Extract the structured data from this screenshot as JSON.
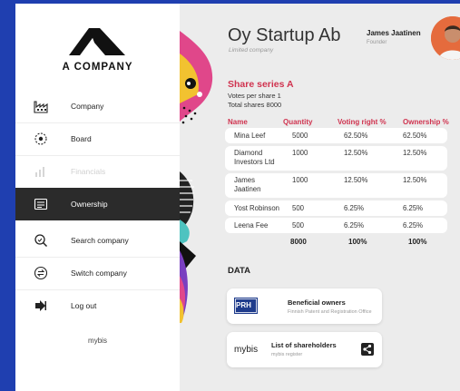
{
  "brand": {
    "company": "A COMPANY",
    "footer": "mybis"
  },
  "nav": [
    {
      "label": "Company",
      "icon": "factory-icon",
      "state": "normal"
    },
    {
      "label": "Board",
      "icon": "board-icon",
      "state": "normal"
    },
    {
      "label": "Financials",
      "icon": "financials-icon",
      "state": "disabled"
    },
    {
      "label": "Ownership",
      "icon": "ownership-icon",
      "state": "active"
    },
    {
      "label": "Search company",
      "icon": "search-icon",
      "state": "normal"
    },
    {
      "label": "Switch company",
      "icon": "switch-icon",
      "state": "normal"
    },
    {
      "label": "Log out",
      "icon": "logout-icon",
      "state": "normal"
    }
  ],
  "header": {
    "company_name": "Oy Startup Ab",
    "company_type": "Limited company",
    "user_name": "James Jaatinen",
    "user_role": "Founder"
  },
  "share_series": {
    "title": "Share series A",
    "votes_per_share": "Votes per share 1",
    "total_shares": "Total shares 8000"
  },
  "table": {
    "columns": [
      "Name",
      "Quantity",
      "Voting right %",
      "Ownership %"
    ],
    "rows": [
      {
        "name": "Mina Leef",
        "quantity": "5000",
        "voting": "62.50%",
        "ownership": "62.50%"
      },
      {
        "name": "Diamond Investors Ltd",
        "quantity": "1000",
        "voting": "12.50%",
        "ownership": "12.50%"
      },
      {
        "name": "James Jaatinen",
        "quantity": "1000",
        "voting": "12.50%",
        "ownership": "12.50%"
      },
      {
        "name": "Yost Robinson",
        "quantity": "500",
        "voting": "6.25%",
        "ownership": "6.25%"
      },
      {
        "name": "Leena Fee",
        "quantity": "500",
        "voting": "6.25%",
        "ownership": "6.25%"
      }
    ],
    "totals": {
      "quantity": "8000",
      "voting": "100%",
      "ownership": "100%"
    }
  },
  "data_section": {
    "title": "DATA",
    "cards": [
      {
        "logo": "PRH",
        "title": "Beneficial owners",
        "subtitle": "Finnish Patent and Registration Office"
      },
      {
        "logo": "mybis",
        "title": "List of shareholders",
        "subtitle": "mybis register"
      }
    ]
  },
  "colors": {
    "accent": "#d0334f",
    "background": "#1f3fb0",
    "active_nav": "#2b2b2b",
    "prh_blue": "#1f3c8c"
  }
}
